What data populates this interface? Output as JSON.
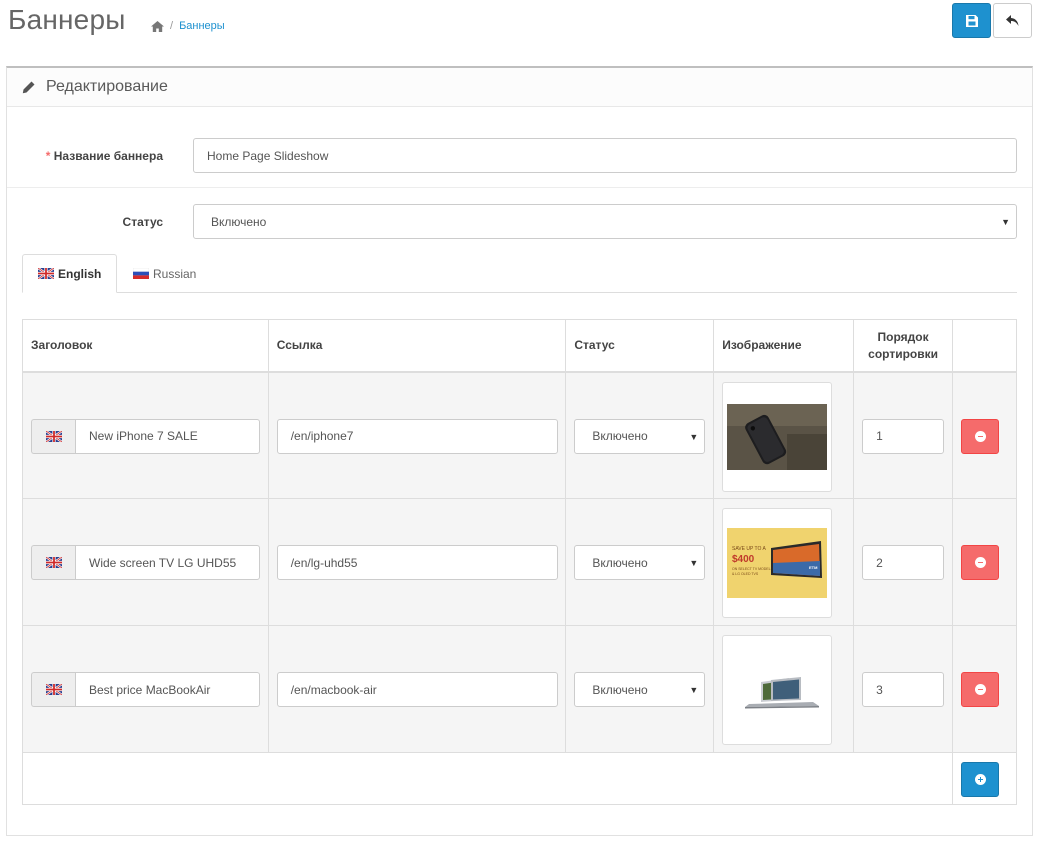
{
  "header": {
    "title": "Баннеры",
    "breadcrumb": {
      "separator": "/",
      "current": "Баннеры"
    },
    "save_icon": "floppy-disk-icon",
    "back_icon": "reply-arrow-icon"
  },
  "panel": {
    "heading": "Редактирование",
    "heading_icon": "pencil-icon"
  },
  "form": {
    "name_required_mark": "*",
    "name_label": "Название баннера",
    "name_value": "Home Page Slideshow",
    "status_label": "Статус",
    "status_value": "Включено"
  },
  "tabs": [
    {
      "label": "English",
      "flag": "uk-flag-icon",
      "active": true
    },
    {
      "label": "Russian",
      "flag": "russia-flag-icon",
      "active": false
    }
  ],
  "table": {
    "headers": {
      "title": "Заголовок",
      "link": "Ссылка",
      "status": "Статус",
      "image": "Изображение",
      "sort_line1": "Порядок",
      "sort_line2": "сортировки"
    },
    "rows": [
      {
        "title": "New iPhone 7 SALE",
        "link": "/en/iphone7",
        "status": "Включено",
        "image": "iphone-photo",
        "sort": "1"
      },
      {
        "title": "Wide screen TV LG UHD55",
        "link": "/en/lg-uhd55",
        "status": "Включено",
        "image": "tv-promo-banner",
        "sort": "2"
      },
      {
        "title": "Best price MacBookAir",
        "link": "/en/macbook-air",
        "status": "Включено",
        "image": "macbook-photo",
        "sort": "3"
      }
    ]
  },
  "thumb_texts": {
    "tv_line1": "SAVE UP TO A",
    "tv_amount": "$400",
    "tv_line2": "ON SELECT TV MODELS",
    "tv_line3": "& LG OLED TVS",
    "tv_brand": "ЕТМ"
  },
  "colors": {
    "primary": "#1e91cf",
    "danger": "#f56b6b",
    "link": "#1e91cf"
  }
}
